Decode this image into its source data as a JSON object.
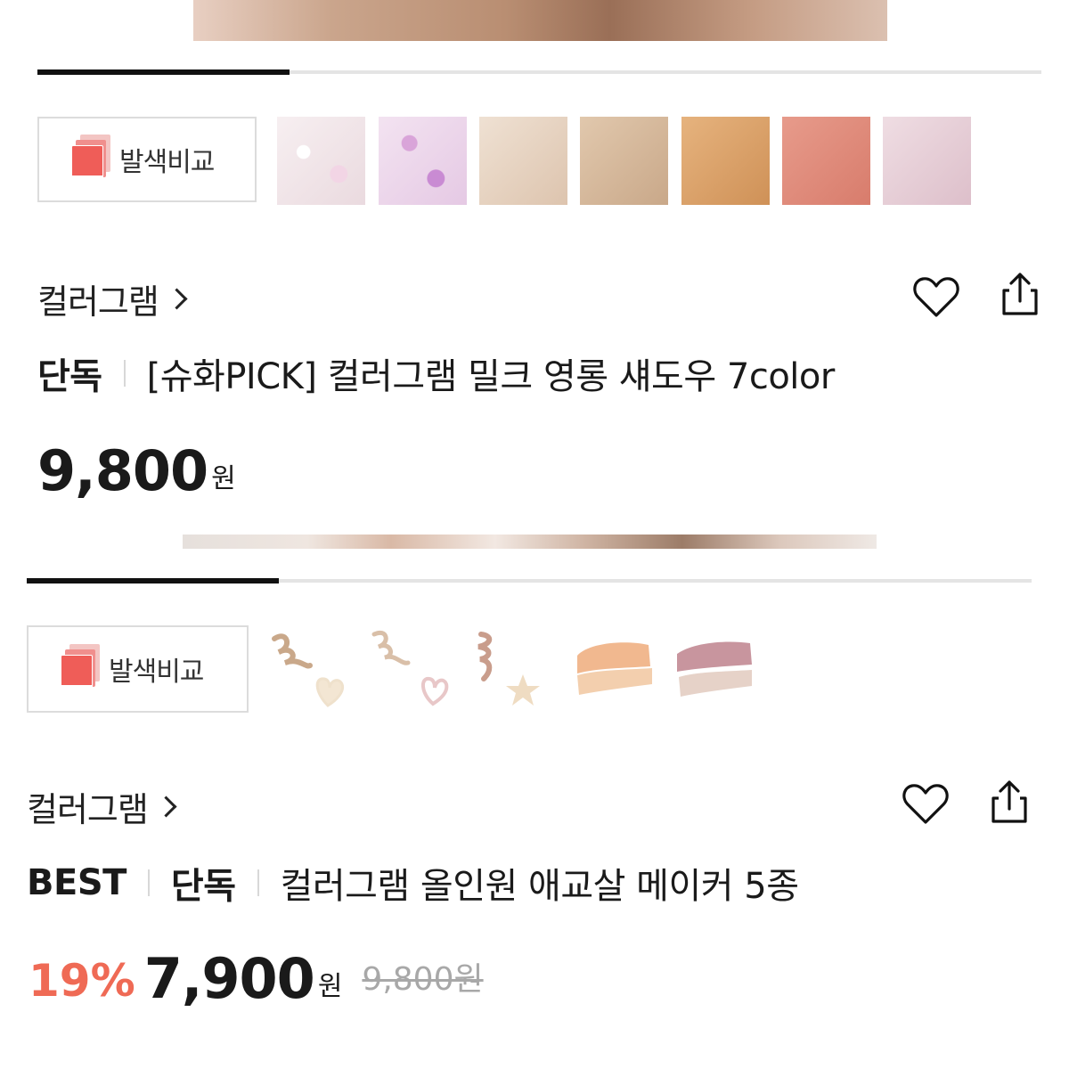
{
  "products": [
    {
      "compare_label": "발색비교",
      "brand": "컬러그램",
      "tags": [
        "단독"
      ],
      "title": "[슈화PICK] 컬러그램 밀크 영롱 섀도우 7color",
      "price": "9,800",
      "currency": "원",
      "swatch_colors": [
        "#f3e8ea",
        "#ead6ec",
        "#e9d6c7",
        "#d8bca0",
        "#d8a06a",
        "#dd8a7c",
        "#e6cdd6"
      ],
      "slider_progress": 0.25
    },
    {
      "compare_label": "발색비교",
      "brand": "컬러그램",
      "tags": [
        "BEST",
        "단독"
      ],
      "title": "컬러그램 올인원 애교살 메이커 5종",
      "discount": "19%",
      "price": "7,900",
      "currency": "원",
      "original_price": "9,800원",
      "swatch_colors": [
        "#c9a88a",
        "#d9bfa8",
        "#c99d8c",
        "#f1b88f",
        "#c8959e"
      ],
      "slider_progress": 0.25
    }
  ],
  "icons": {
    "wishlist": "heart-icon",
    "share": "share-icon",
    "brand_link": "chevron-right-icon"
  },
  "colors": {
    "discount": "#ef6a55",
    "text": "#1a1a1a",
    "strikethrough": "#a8a8a8"
  }
}
